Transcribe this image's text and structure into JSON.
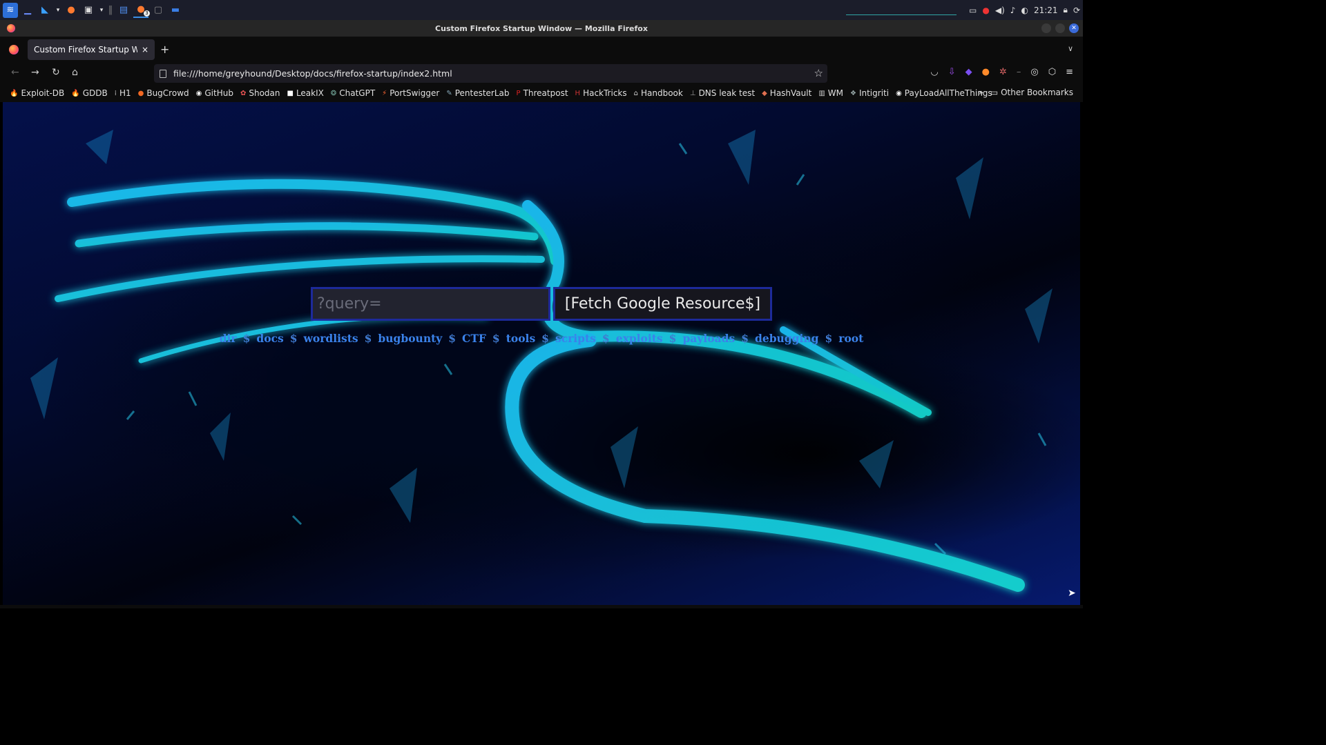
{
  "panel": {
    "clock": "21:21",
    "taskbar_badge": "3"
  },
  "window": {
    "title": "Custom Firefox Startup Window — Mozilla Firefox"
  },
  "tab": {
    "title": "Custom Firefox Startup Window",
    "close": "×",
    "new": "+"
  },
  "url": "file:///home/greyhound/Desktop/docs/firefox-startup/index2.html",
  "bookmarks": [
    {
      "label": "Exploit-DB",
      "icon": "🔥",
      "color": "#ff6a1a"
    },
    {
      "label": "GDDB",
      "icon": "🔥",
      "color": "#ff6a1a"
    },
    {
      "label": "H1",
      "icon": "⁞",
      "color": "#cccccc"
    },
    {
      "label": "BugCrowd",
      "icon": "●",
      "color": "#f26822"
    },
    {
      "label": "GitHub",
      "icon": "◉",
      "color": "#eeeeee"
    },
    {
      "label": "Shodan",
      "icon": "✿",
      "color": "#e55"
    },
    {
      "label": "LeakIX",
      "icon": "■",
      "color": "#ffffff"
    },
    {
      "label": "ChatGPT",
      "icon": "❂",
      "color": "#74aa9c"
    },
    {
      "label": "PortSwigger",
      "icon": "⚡",
      "color": "#ff6633"
    },
    {
      "label": "PentesterLab",
      "icon": "✎",
      "color": "#8ab"
    },
    {
      "label": "Threatpost",
      "icon": "P",
      "color": "#d22"
    },
    {
      "label": "HackTricks",
      "icon": "H",
      "color": "#c33"
    },
    {
      "label": "Handbook",
      "icon": "⌂",
      "color": "#ccc"
    },
    {
      "label": "DNS leak test",
      "icon": "⊥",
      "color": "#999"
    },
    {
      "label": "HashVault",
      "icon": "◆",
      "color": "#e07050"
    },
    {
      "label": "WM",
      "icon": "▥",
      "color": "#ccc"
    },
    {
      "label": "Intigriti",
      "icon": "❖",
      "color": "#9aa"
    },
    {
      "label": "PayLoadAllTheThings",
      "icon": "◉",
      "color": "#eee"
    }
  ],
  "bookmarks_more": "»",
  "other_bookmarks": "Other Bookmarks",
  "page": {
    "search_placeholder": "?query=",
    "fetch_button": "[Fetch Google Resource$]",
    "links": [
      "dir",
      "docs",
      "wordlists",
      "bugbounty",
      "CTF",
      "tools",
      "scripts",
      "exploits",
      "payloads",
      "debugging",
      "root"
    ],
    "separator": "$"
  }
}
